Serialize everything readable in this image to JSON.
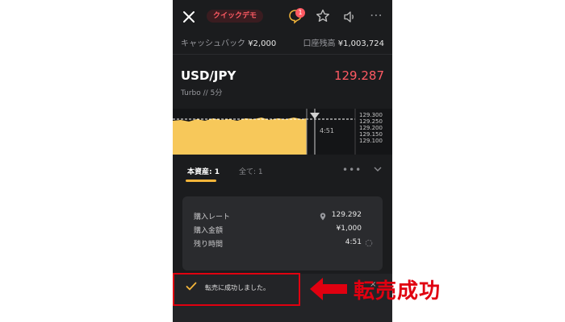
{
  "header": {
    "demo_badge": "クイックデモ",
    "notification_count": "1"
  },
  "account": {
    "cashback_label": "キャッシュバック",
    "cashback_value": "¥2,000",
    "balance_label": "口座残高",
    "balance_value": "¥1,003,724"
  },
  "asset": {
    "pair": "USD/JPY",
    "price": "129.287",
    "mode": "Turbo",
    "separator": "//",
    "duration": "5分"
  },
  "chart": {
    "y_ticks": [
      "129.300",
      "129.250",
      "129.200",
      "129.150",
      "129.100"
    ],
    "timer": "4:51",
    "colors": {
      "area": "#f7c85a",
      "background": "#141517"
    }
  },
  "tabs": {
    "main": "本資産: 1",
    "all": "全て: 1",
    "more": "•••"
  },
  "position": {
    "rows": [
      {
        "label": "購入レート",
        "value": "129.292"
      },
      {
        "label": "購入金額",
        "value": "¥1,000"
      },
      {
        "label": "残り時間",
        "value": "4:51"
      }
    ]
  },
  "toast": {
    "message": "転売に成功しました。",
    "close": "×"
  },
  "annotation": {
    "text": "転売成功",
    "color": "#e00010"
  }
}
